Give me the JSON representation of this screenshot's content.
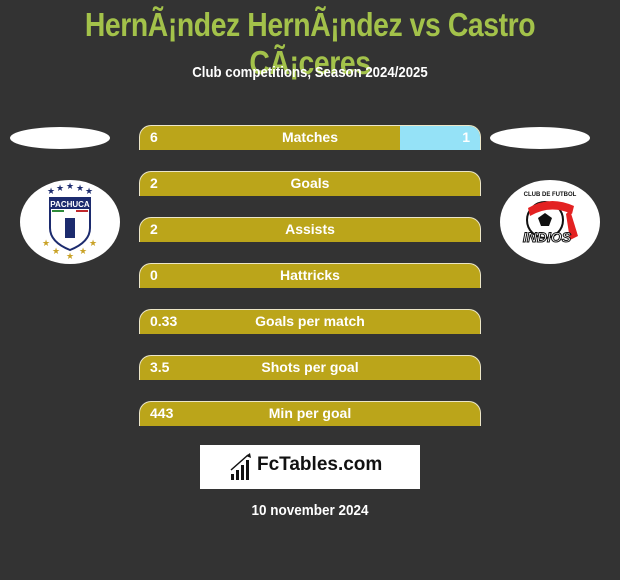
{
  "header": {
    "title": "HernÃ¡ndez HernÃ¡ndez vs Castro CÃ¡ceres",
    "subtitle": "Club competitions, Season 2024/2025"
  },
  "teams": {
    "left": {
      "logo": "pachuca-crest-icon",
      "logo_text": "PACHUCA"
    },
    "right": {
      "logo": "indios-crest-icon",
      "logo_text": "INDIOS",
      "logo_subtext": "CLUB DE FUTBOL"
    }
  },
  "colors": {
    "background": "#333333",
    "title": "#a3c24a",
    "left_bar": "#bba51a",
    "right_bar": "#95e2f7"
  },
  "stats": [
    {
      "label": "Matches",
      "left": "6",
      "right": "1",
      "right_share": 0.236
    },
    {
      "label": "Goals",
      "left": "2",
      "right": "",
      "right_share": 0
    },
    {
      "label": "Assists",
      "left": "2",
      "right": "",
      "right_share": 0
    },
    {
      "label": "Hattricks",
      "left": "0",
      "right": "",
      "right_share": 0
    },
    {
      "label": "Goals per match",
      "left": "0.33",
      "right": "",
      "right_share": 0
    },
    {
      "label": "Shots per goal",
      "left": "3.5",
      "right": "",
      "right_share": 0
    },
    {
      "label": "Min per goal",
      "left": "443",
      "right": "",
      "right_share": 0
    }
  ],
  "footer": {
    "brand": "FcTables.com",
    "brand_icon": "bar-chart-icon",
    "date": "10 november 2024"
  }
}
